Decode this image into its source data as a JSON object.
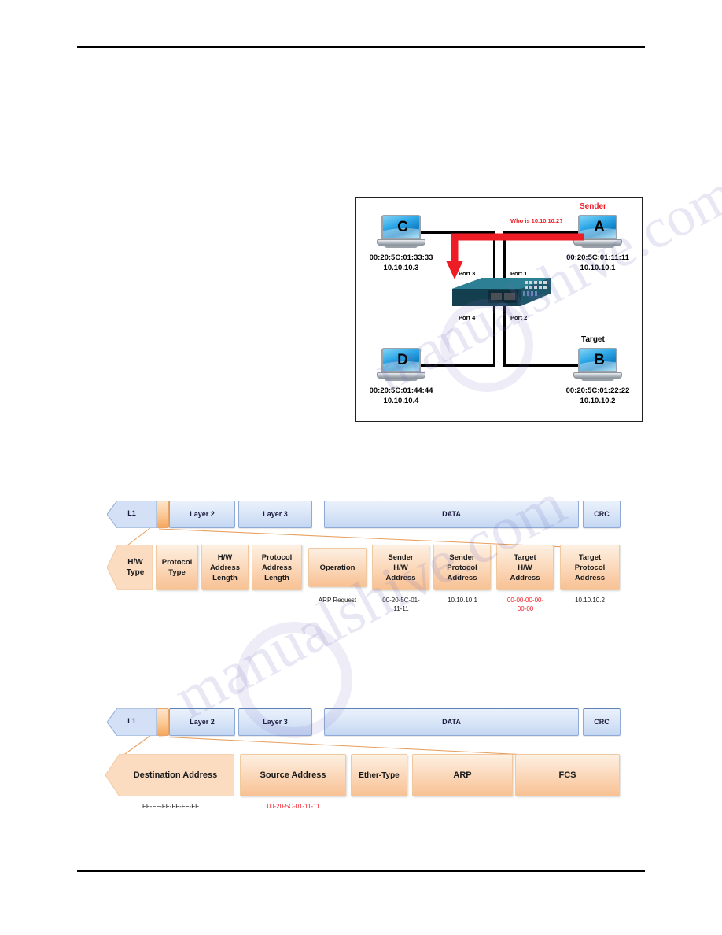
{
  "page": {
    "header_rule": true,
    "footer_rule": true,
    "watermark_text_a": "manualshive.com",
    "watermark_text_b": "manualshive.com"
  },
  "network_figure": {
    "name": "arp-request-topology",
    "nodes": [
      {
        "id": "C",
        "letter": "C",
        "mac": "00:20:5C:01:33:33",
        "ip": "10.10.10.3",
        "role": ""
      },
      {
        "id": "A",
        "letter": "A",
        "mac": "00:20:5C:01:11:11",
        "ip": "10.10.10.1",
        "role": "Sender",
        "role_color": "#ee1c25"
      },
      {
        "id": "D",
        "letter": "D",
        "mac": "00:20:5C:01:44:44",
        "ip": "10.10.10.4",
        "role": ""
      },
      {
        "id": "B",
        "letter": "B",
        "mac": "00:20:5C:01:22:22",
        "ip": "10.10.10.2",
        "role": "Target",
        "role_color": "#000000"
      }
    ],
    "ports": [
      {
        "label": "Port 3"
      },
      {
        "label": "Port 1"
      },
      {
        "label": "Port 4"
      },
      {
        "label": "Port 2"
      }
    ],
    "annotation": {
      "text": "Who is 10.10.10.2?",
      "color": "#ee1c25"
    }
  },
  "arp_diagram": {
    "name": "arp-packet-breakdown",
    "top_bar": {
      "segments": [
        {
          "label": "L1",
          "shape": "arrow-left"
        },
        {
          "label": "",
          "shape": "tab"
        },
        {
          "label": "Layer 2",
          "shape": "rect"
        },
        {
          "label": "Layer 3",
          "shape": "rect"
        },
        {
          "label": "DATA",
          "shape": "rect"
        },
        {
          "label": "CRC",
          "shape": "rect"
        }
      ]
    },
    "fields": [
      {
        "label": "H/W\nType",
        "value": "",
        "value_color": "#1a1a1a"
      },
      {
        "label": "Protocol\nType",
        "value": "",
        "value_color": "#1a1a1a"
      },
      {
        "label": "H/W\nAddress\nLength",
        "value": "",
        "value_color": "#1a1a1a"
      },
      {
        "label": "Protocol\nAddress\nLength",
        "value": "",
        "value_color": "#1a1a1a"
      },
      {
        "label": "Operation",
        "value": "ARP Request",
        "value_color": "#1a1a1a"
      },
      {
        "label": "Sender\nH/W\nAddress",
        "value": "00-20-5C-01-\n11-11",
        "value_color": "#1a1a1a"
      },
      {
        "label": "Sender\nProtocol\nAddress",
        "value": "10.10.10.1",
        "value_color": "#1a1a1a"
      },
      {
        "label": "Target\nH/W\nAddress",
        "value": "00-00-00-00-\n00-00",
        "value_color": "#ee1c25"
      },
      {
        "label": "Target\nProtocol\nAddress",
        "value": "10.10.10.2",
        "value_color": "#1a1a1a"
      }
    ]
  },
  "ethernet_diagram": {
    "name": "ethernet-frame-breakdown",
    "top_bar": {
      "segments": [
        {
          "label": "L1",
          "shape": "arrow-left"
        },
        {
          "label": "",
          "shape": "tab"
        },
        {
          "label": "Layer 2",
          "shape": "rect"
        },
        {
          "label": "Layer 3",
          "shape": "rect"
        },
        {
          "label": "DATA",
          "shape": "rect"
        },
        {
          "label": "CRC",
          "shape": "rect"
        }
      ]
    },
    "fields": [
      {
        "label": "Destination Address",
        "value": "FF-FF-FF-FF-FF-FF",
        "value_color": "#1a1a1a"
      },
      {
        "label": "Source Address",
        "value": "00-20-5C-01-11-11",
        "value_color": "#ee1c25"
      },
      {
        "label": "Ether-Type",
        "value": "",
        "value_color": "#1a1a1a"
      },
      {
        "label": "ARP",
        "value": "",
        "value_color": "#1a1a1a"
      },
      {
        "label": "FCS",
        "value": "",
        "value_color": "#1a1a1a"
      }
    ]
  },
  "colors": {
    "blue_bar_fill": "#dbe7f8",
    "blue_bar_border": "#8faad4",
    "orange_fill": "#fbdcc1",
    "orange_border": "#f0c9a0",
    "accent_red": "#ee1c25",
    "rule_black": "#000000"
  }
}
